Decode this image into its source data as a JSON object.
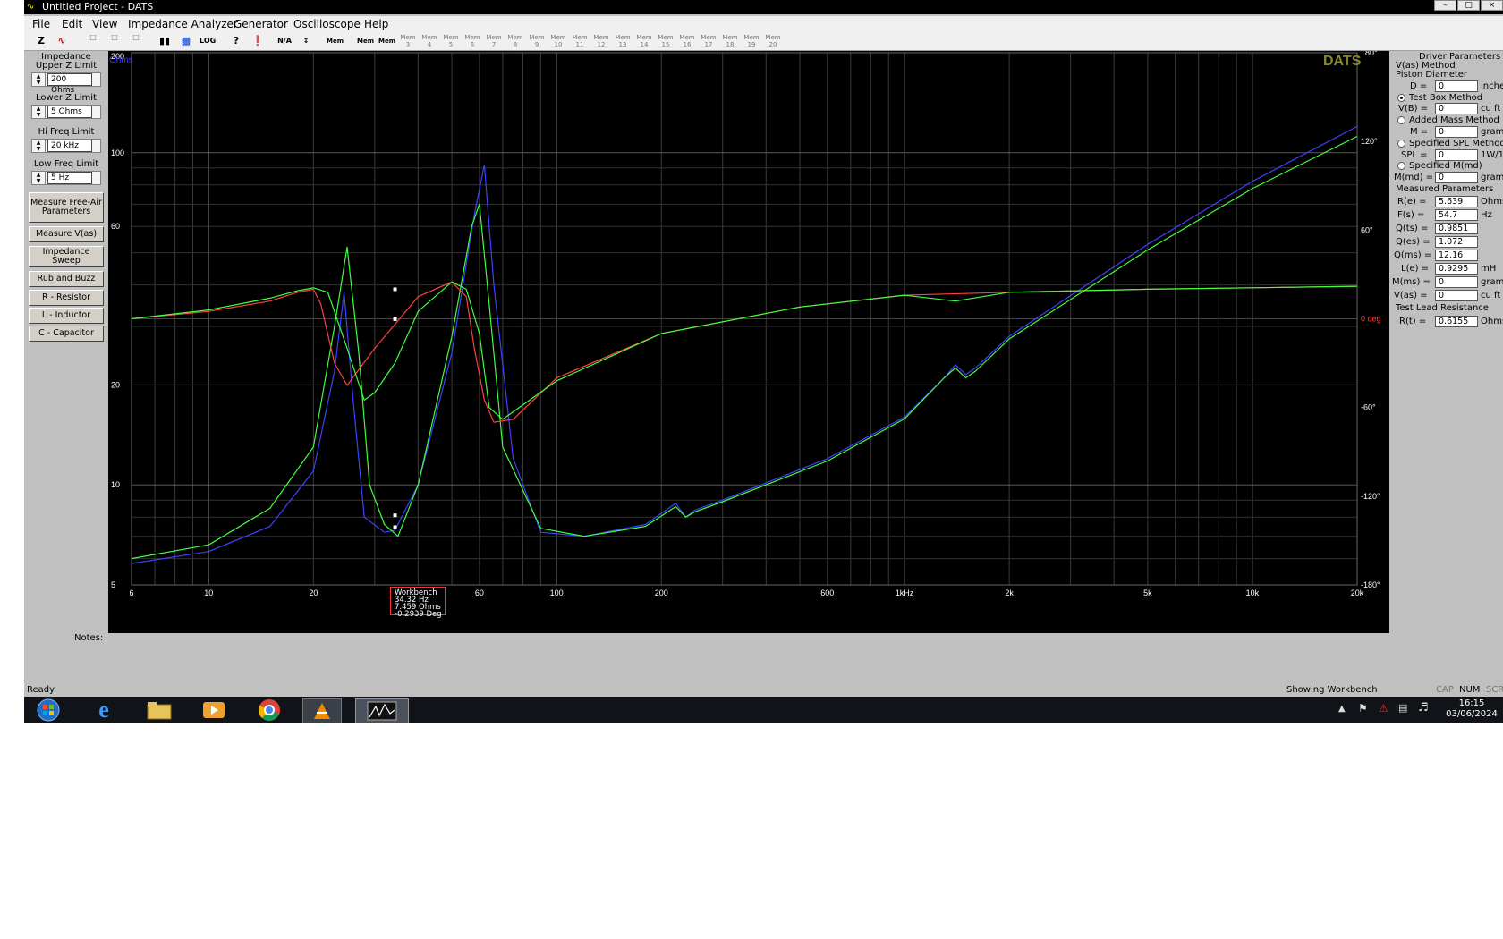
{
  "window": {
    "title": "Untitled Project - DATS"
  },
  "menu": [
    "File",
    "Edit",
    "View",
    "Impedance Analyzer",
    "Generator",
    "Oscilloscope",
    "Help"
  ],
  "toolbar": {
    "mem_buttons": [
      "Mem 1",
      "Mem 2",
      "Mem 3",
      "Mem 4",
      "Mem 5",
      "Mem 6",
      "Mem 7",
      "Mem 8",
      "Mem 9",
      "Mem 10",
      "Mem 11",
      "Mem 12",
      "Mem 13",
      "Mem 14",
      "Mem 15",
      "Mem 16",
      "Mem 17",
      "Mem 18",
      "Mem 19",
      "Mem 20"
    ]
  },
  "left_panel": {
    "upper_z_label": "Impedance Upper Z Limit",
    "upper_z_value": "200 Ohms",
    "lower_z_label": "Lower Z Limit",
    "lower_z_value": "5 Ohms",
    "hi_freq_label": "Hi Freq Limit",
    "hi_freq_value": "20 kHz",
    "low_freq_label": "Low Freq Limit",
    "low_freq_value": "5 Hz",
    "buttons": [
      "Measure Free-Air Parameters",
      "Measure V(as)",
      "Impedance Sweep",
      "Rub and Buzz",
      "R - Resistor",
      "L - Inductor",
      "C - Capacitor"
    ]
  },
  "plot": {
    "brand": "DATS",
    "left_axis_unit": "Ohms",
    "left_ticks": [
      "200",
      "100",
      "60",
      "20",
      "10",
      "5"
    ],
    "right_ticks": [
      "180°",
      "120°",
      "60°",
      "0 deg",
      "-60°",
      "-120°",
      "-180°"
    ],
    "x_ticks": [
      "6",
      "10",
      "20",
      "60",
      "100",
      "200",
      "600",
      "1kHz",
      "2k",
      "5k",
      "10k",
      "20k"
    ],
    "marker": {
      "title": "Workbench",
      "freq": "34.32 Hz",
      "impedance": "7.459 Ohms",
      "phase": "-0.2939 Deg"
    }
  },
  "chart_data": {
    "type": "line",
    "title": "",
    "xlabel": "",
    "ylabel": "Ohms",
    "x_scale": "log",
    "xlim": [
      6,
      20000
    ],
    "ylim": [
      5,
      200
    ],
    "y_scale": "log",
    "y2lim": [
      -180,
      180
    ],
    "y2label": "deg",
    "series": [
      {
        "axis": "impedance",
        "color": "#4040ff",
        "x": [
          6,
          10,
          15,
          20,
          23,
          24.5,
          26,
          28,
          32,
          34.3,
          40,
          50,
          58,
          62,
          66,
          75,
          90,
          120,
          180,
          220,
          235,
          250,
          300,
          600,
          1000,
          1300,
          1400,
          1500,
          1600,
          2000,
          5000,
          10000,
          20000
        ],
        "y": [
          5.8,
          6.3,
          7.5,
          11,
          22,
          38,
          18,
          8,
          7.2,
          7.3,
          10,
          25,
          65,
          92,
          40,
          12,
          7.2,
          7.0,
          7.6,
          8.8,
          8.0,
          8.4,
          9.0,
          12,
          16,
          21,
          23,
          21.5,
          22.5,
          28,
          53,
          82,
          120
        ]
      },
      {
        "axis": "impedance",
        "color": "#40ff40",
        "x": [
          6,
          10,
          15,
          20,
          23,
          25,
          27,
          29,
          32,
          35,
          40,
          50,
          57,
          60,
          64,
          70,
          90,
          120,
          180,
          220,
          235,
          250,
          300,
          600,
          1000,
          1300,
          1400,
          1500,
          1600,
          2000,
          5000,
          10000,
          20000
        ],
        "y": [
          6.0,
          6.6,
          8.5,
          13,
          30,
          52,
          25,
          10,
          7.6,
          7.0,
          10,
          28,
          60,
          70,
          35,
          13,
          7.4,
          7.0,
          7.5,
          8.6,
          8.0,
          8.3,
          8.9,
          11.8,
          15.8,
          21,
          22.5,
          21,
          22,
          27.5,
          51,
          78,
          112
        ]
      },
      {
        "axis": "phase",
        "color": "#ff4040",
        "x": [
          6,
          10,
          15,
          18,
          20,
          21,
          23,
          25,
          30,
          40,
          50,
          55,
          58,
          62,
          66,
          75,
          100,
          200,
          500,
          1000,
          2000,
          5000,
          10000,
          20000
        ],
        "y": [
          0,
          5,
          12,
          18,
          20,
          10,
          -30,
          -45,
          -20,
          15,
          25,
          15,
          -20,
          -55,
          -70,
          -68,
          -40,
          -10,
          8,
          16,
          18,
          20,
          21,
          22
        ]
      },
      {
        "axis": "phase",
        "color": "#40ff40",
        "x": [
          6,
          10,
          15,
          18,
          20,
          22,
          25,
          28,
          30,
          34.3,
          40,
          50,
          55,
          60,
          64,
          70,
          100,
          200,
          500,
          1000,
          1400,
          2000,
          5000,
          10000,
          20000
        ],
        "y": [
          0,
          6,
          14,
          19,
          21,
          18,
          -20,
          -55,
          -50,
          -30,
          5,
          25,
          20,
          -10,
          -60,
          -68,
          -42,
          -10,
          8,
          16,
          12,
          18,
          20,
          21,
          22
        ]
      }
    ]
  },
  "right_panel": {
    "header": "Driver Parameters",
    "vas_method_label": "V(as) Method",
    "piston_label": "Piston Diameter",
    "d_label": "D =",
    "d_value": "0",
    "d_unit": "inches",
    "test_box_label": "Test Box Method",
    "vb_label": "V(B) =",
    "vb_value": "0",
    "vb_unit": "cu ft",
    "added_mass_label": "Added Mass Method",
    "m_label": "M =",
    "m_value": "0",
    "m_unit": "grams",
    "spl_method_label": "Specified SPL Method",
    "spl_label": "SPL =",
    "spl_value": "0",
    "spl_unit": "1W/1m",
    "mmd_method_label": "Specified M(md)",
    "mmd_label": "M(md) =",
    "mmd_value": "0",
    "mmd_unit": "grams",
    "measured_label": "Measured Parameters",
    "re_label": "R(e) =",
    "re_value": "5.639",
    "re_unit": "Ohms",
    "fs_label": "F(s) =",
    "fs_value": "54.7",
    "fs_unit": "Hz",
    "qts_label": "Q(ts) =",
    "qts_value": "0.9851",
    "qes_label": "Q(es) =",
    "qes_value": "1.072",
    "qms_label": "Q(ms) =",
    "qms_value": "12.16",
    "le_label": "L(e) =",
    "le_value": "0.9295",
    "le_unit": "mH",
    "mms_label": "M(ms) =",
    "mms_value": "0",
    "mms_unit": "grams",
    "vas_label": "V(as) =",
    "vas_value": "0",
    "vas_unit": "cu ft",
    "lead_label": "Test Lead Resistance",
    "rt_label": "R(t) =",
    "rt_value": "0.6155",
    "rt_unit": "Ohms"
  },
  "notes_label": "Notes:",
  "status": {
    "left": "Ready",
    "middle": "Showing Workbench",
    "cap": "CAP",
    "num": "NUM",
    "scrl": "SCRL"
  },
  "taskbar": {
    "time": "16:15",
    "date": "03/06/2024"
  }
}
